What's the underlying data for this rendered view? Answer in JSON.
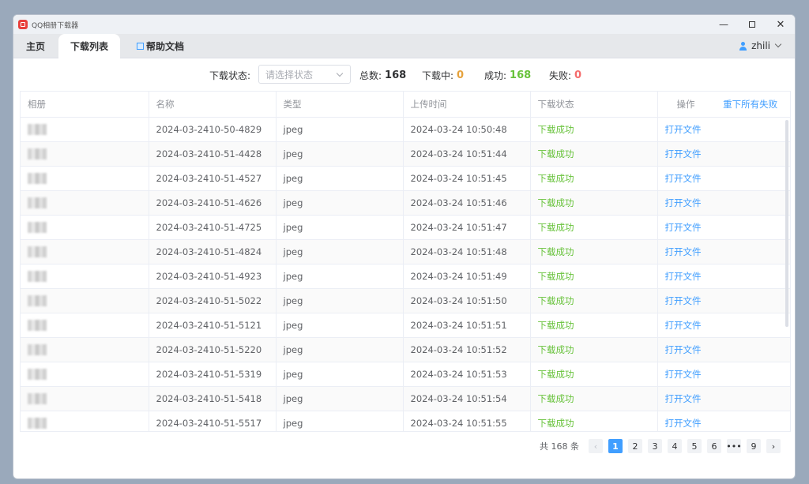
{
  "window": {
    "title": "QQ相册下载器"
  },
  "tabs": [
    {
      "label": "主页"
    },
    {
      "label": "下载列表"
    },
    {
      "label": "帮助文档"
    }
  ],
  "user": {
    "name": "zhili"
  },
  "filter": {
    "status_label": "下载状态:",
    "status_placeholder": "请选择状态",
    "total_label": "总数:",
    "total_value": "168",
    "downloading_label": "下载中:",
    "downloading_value": "0",
    "success_label": "成功:",
    "success_value": "168",
    "failed_label": "失败:",
    "failed_value": "0"
  },
  "colors": {
    "accent": "#409eff",
    "success": "#67c23a",
    "warning": "#e6a23c",
    "danger": "#f56c6c"
  },
  "table": {
    "headers": {
      "album": "相册",
      "name": "名称",
      "type": "类型",
      "upload_time": "上传时间",
      "status": "下载状态",
      "action": "操作",
      "retry_all": "重下所有失败"
    },
    "rows": [
      {
        "name": "2024-03-2410-50-4829",
        "type": "jpeg",
        "upload_time": "2024-03-24 10:50:48",
        "status": "下载成功",
        "action": "打开文件"
      },
      {
        "name": "2024-03-2410-51-4428",
        "type": "jpeg",
        "upload_time": "2024-03-24 10:51:44",
        "status": "下载成功",
        "action": "打开文件"
      },
      {
        "name": "2024-03-2410-51-4527",
        "type": "jpeg",
        "upload_time": "2024-03-24 10:51:45",
        "status": "下载成功",
        "action": "打开文件"
      },
      {
        "name": "2024-03-2410-51-4626",
        "type": "jpeg",
        "upload_time": "2024-03-24 10:51:46",
        "status": "下载成功",
        "action": "打开文件"
      },
      {
        "name": "2024-03-2410-51-4725",
        "type": "jpeg",
        "upload_time": "2024-03-24 10:51:47",
        "status": "下载成功",
        "action": "打开文件"
      },
      {
        "name": "2024-03-2410-51-4824",
        "type": "jpeg",
        "upload_time": "2024-03-24 10:51:48",
        "status": "下载成功",
        "action": "打开文件"
      },
      {
        "name": "2024-03-2410-51-4923",
        "type": "jpeg",
        "upload_time": "2024-03-24 10:51:49",
        "status": "下载成功",
        "action": "打开文件"
      },
      {
        "name": "2024-03-2410-51-5022",
        "type": "jpeg",
        "upload_time": "2024-03-24 10:51:50",
        "status": "下载成功",
        "action": "打开文件"
      },
      {
        "name": "2024-03-2410-51-5121",
        "type": "jpeg",
        "upload_time": "2024-03-24 10:51:51",
        "status": "下载成功",
        "action": "打开文件"
      },
      {
        "name": "2024-03-2410-51-5220",
        "type": "jpeg",
        "upload_time": "2024-03-24 10:51:52",
        "status": "下载成功",
        "action": "打开文件"
      },
      {
        "name": "2024-03-2410-51-5319",
        "type": "jpeg",
        "upload_time": "2024-03-24 10:51:53",
        "status": "下载成功",
        "action": "打开文件"
      },
      {
        "name": "2024-03-2410-51-5418",
        "type": "jpeg",
        "upload_time": "2024-03-24 10:51:54",
        "status": "下载成功",
        "action": "打开文件"
      },
      {
        "name": "2024-03-2410-51-5517",
        "type": "jpeg",
        "upload_time": "2024-03-24 10:51:55",
        "status": "下载成功",
        "action": "打开文件"
      }
    ]
  },
  "pagination": {
    "total_text": "共 168 条",
    "pages": [
      "1",
      "2",
      "3",
      "4",
      "5",
      "6",
      "•••",
      "9"
    ],
    "current": "1"
  }
}
